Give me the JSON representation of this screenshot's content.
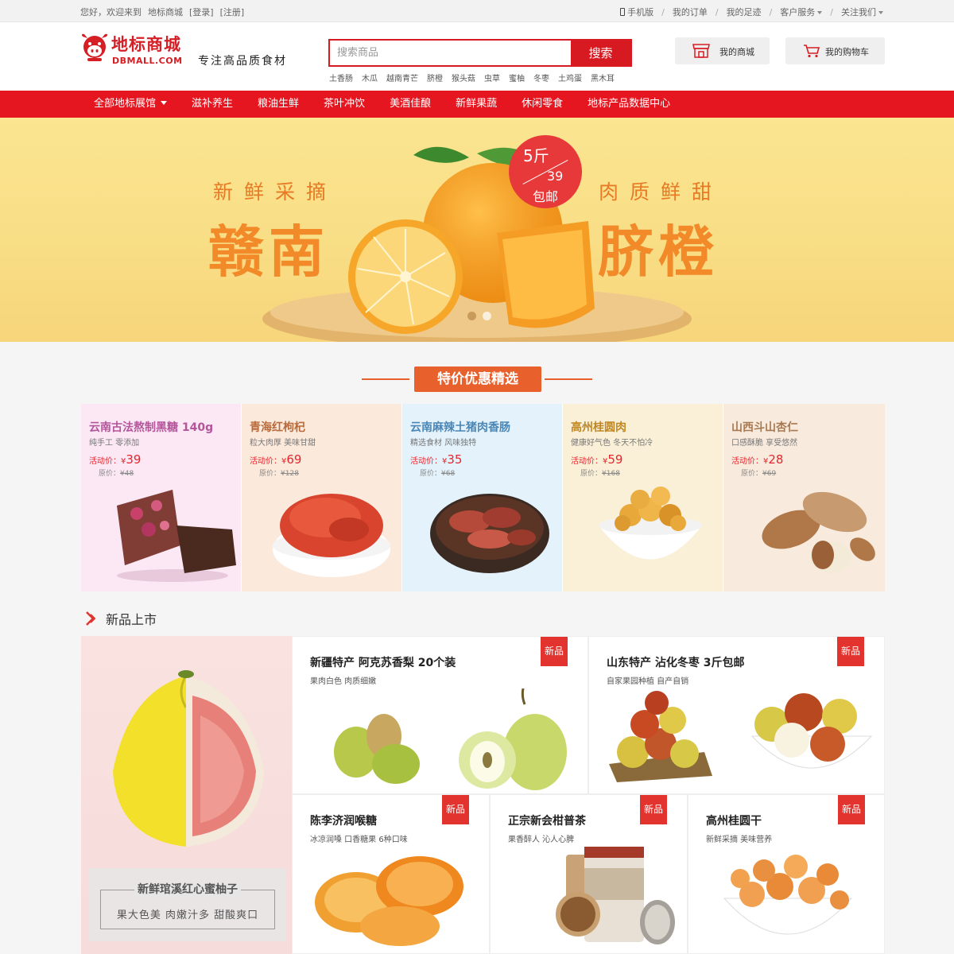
{
  "topbar": {
    "welcome": "您好，欢迎来到",
    "site_name": "地标商城",
    "login": "[登录]",
    "register": "[注册]",
    "mobile": "手机版",
    "orders": "我的订单",
    "footprint": "我的足迹",
    "service": "客户服务",
    "follow": "关注我们"
  },
  "header": {
    "logo_cn": "地标商城",
    "logo_en": "DBMALL.COM",
    "slogan": "专注高品质食材",
    "search_placeholder": "搜索商品",
    "search_button": "搜索",
    "hot_words": [
      "土香肠",
      "木瓜",
      "越南青芒",
      "脐橙",
      "猴头菇",
      "虫草",
      "蜜柚",
      "冬枣",
      "土鸡蛋",
      "黑木耳"
    ],
    "my_mall": "我的商城",
    "my_cart": "我的购物车"
  },
  "nav": {
    "items": [
      "全部地标展馆",
      "滋补养生",
      "粮油生鲜",
      "茶叶冲饮",
      "美酒佳酿",
      "新鲜果蔬",
      "休闲零食",
      "地标产品数据中心"
    ]
  },
  "banner": {
    "left_small": "新鲜采摘",
    "right_small": "肉质鲜甜",
    "left_big": "赣南",
    "right_big": "脐橙",
    "badge_top": "5斤",
    "badge_price": "39",
    "badge_bottom": "包邮",
    "colors": {
      "orange_text": "#f28a2a",
      "badge": "#e8393a"
    }
  },
  "special": {
    "title": "特价优惠精选",
    "price_label": "活动价：",
    "orig_label": "原价：",
    "currency": "¥",
    "items": [
      {
        "title": "云南古法熬制黑糖 140g",
        "sub": "纯手工   零添加",
        "price": "39",
        "orig": "48",
        "bg": "#fbe8f4",
        "title_color": "#b4559b"
      },
      {
        "title": "青海红枸杞",
        "sub": "粒大肉厚   美味甘甜",
        "price": "69",
        "orig": "128",
        "bg": "#fbe9dc",
        "title_color": "#b86a3a"
      },
      {
        "title": "云南麻辣土猪肉香肠",
        "sub": "精选食材   风味独特",
        "price": "35",
        "orig": "68",
        "bg": "#e4f2fb",
        "title_color": "#4a86b6"
      },
      {
        "title": "高州桂圆肉",
        "sub": "健康好气色   冬天不怕冷",
        "price": "59",
        "orig": "168",
        "bg": "#faf0d8",
        "title_color": "#c0861f"
      },
      {
        "title": "山西斗山杏仁",
        "sub": "口感酥脆   享受悠然",
        "price": "28",
        "orig": "69",
        "bg": "#f8ebde",
        "title_color": "#a87850"
      }
    ]
  },
  "new_products": {
    "heading": "新品上市",
    "tag": "新品",
    "featured": {
      "title": "新鲜琯溪红心蜜柚子",
      "sub": "果大色美   肉嫩汁多   甜酸爽口"
    },
    "items": [
      {
        "title": "新疆特产 阿克苏香梨 20个装",
        "sub": "果肉白色   肉质细嫩"
      },
      {
        "title": "山东特产 沾化冬枣 3斤包邮",
        "sub": "自家果园种植   自产自销"
      },
      {
        "title": "陈李济润喉糖",
        "sub": "冰凉润嗓   口香糖果   6种口味"
      },
      {
        "title": "正宗新会柑普茶",
        "sub": "果香醉人   沁人心脾"
      },
      {
        "title": "高州桂圆干",
        "sub": "新鲜采摘   美味营养"
      }
    ]
  }
}
